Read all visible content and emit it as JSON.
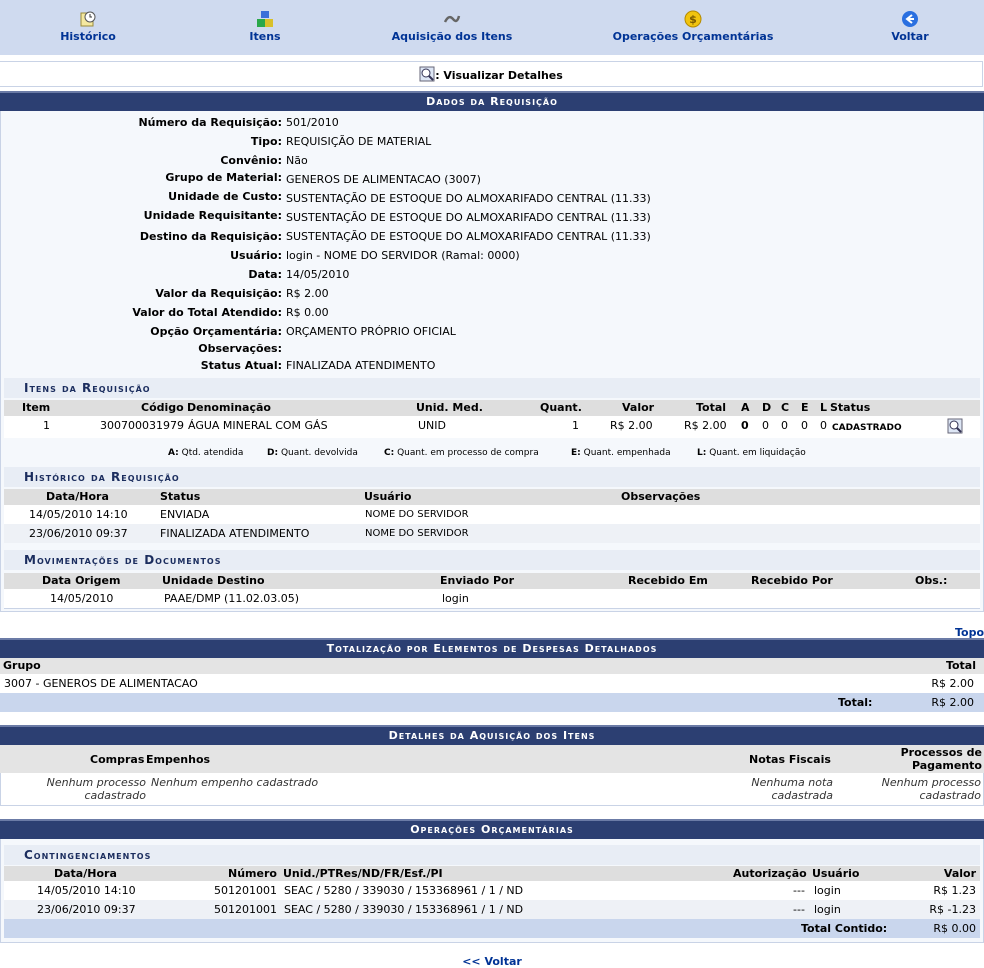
{
  "nav": [
    {
      "label": "Histórico",
      "icon": "clock-doc-icon"
    },
    {
      "label": "Itens",
      "icon": "cubes-icon"
    },
    {
      "label": "Aquisição dos Itens",
      "icon": "handshake-icon"
    },
    {
      "label": "Operações Orçamentárias",
      "icon": "coin-icon"
    },
    {
      "label": "Voltar",
      "icon": "back-arrow-icon"
    }
  ],
  "view_details": ": Visualizar Detalhes",
  "dados": {
    "title": "Dados da Requisição",
    "fields": [
      {
        "label": "Número da Requisição:",
        "value": "501/2010"
      },
      {
        "label": "Tipo:",
        "value": "REQUISIÇÃO DE MATERIAL"
      },
      {
        "label": "Convênio:",
        "value": "Não"
      },
      {
        "label": "Grupo de Material:",
        "value": "GENEROS DE ALIMENTACAO (3007)"
      },
      {
        "label": "Unidade de Custo:",
        "value": "SUSTENTAÇÃO DE ESTOQUE DO ALMOXARIFADO CENTRAL (11.33)"
      },
      {
        "label": "Unidade Requisitante:",
        "value": "SUSTENTAÇÃO DE ESTOQUE DO ALMOXARIFADO CENTRAL (11.33)"
      },
      {
        "label": "Destino da Requisição:",
        "value": "SUSTENTAÇÃO DE ESTOQUE DO ALMOXARIFADO CENTRAL (11.33)"
      },
      {
        "label": "Usuário:",
        "value": "login - NOME DO SERVIDOR (Ramal: 0000)"
      },
      {
        "label": "Data:",
        "value": "14/05/2010"
      },
      {
        "label": "Valor da Requisição:",
        "value": "R$ 2.00"
      },
      {
        "label": "Valor do Total Atendido:",
        "value": "R$ 0.00"
      },
      {
        "label": "Opção Orçamentária:",
        "value": "ORÇAMENTO PRÓPRIO OFICIAL"
      },
      {
        "label": "Observações:",
        "value": ""
      },
      {
        "label": "Status Atual:",
        "value": "FINALIZADA ATENDIMENTO"
      }
    ]
  },
  "itens": {
    "title": "Itens da Requisição",
    "headers": [
      "Item",
      "Código",
      "Denominação",
      "Unid. Med.",
      "Quant.",
      "Valor",
      "Total",
      "A",
      "D",
      "C",
      "E",
      "L",
      "Status"
    ],
    "rows": [
      [
        "1",
        "300700031979",
        "ÁGUA MINERAL COM GÁS",
        "UNID",
        "1",
        "R$ 2.00",
        "R$ 2.00",
        "0",
        "0",
        "0",
        "0",
        "0",
        "CADASTRADO"
      ]
    ],
    "legend": [
      {
        "k": "A:",
        "v": "Qtd. atendida"
      },
      {
        "k": "D:",
        "v": "Quant. devolvida"
      },
      {
        "k": "C:",
        "v": "Quant. em processo de compra"
      },
      {
        "k": "E:",
        "v": "Quant. empenhada"
      },
      {
        "k": "L:",
        "v": "Quant. em liquidação"
      }
    ]
  },
  "historico": {
    "title": "Histórico da Requisição",
    "headers": [
      "Data/Hora",
      "Status",
      "Usuário",
      "Observações"
    ],
    "rows": [
      [
        "14/05/2010 14:10",
        "ENVIADA",
        "NOME DO SERVIDOR",
        ""
      ],
      [
        "23/06/2010 09:37",
        "FINALIZADA ATENDIMENTO",
        "NOME DO SERVIDOR",
        ""
      ]
    ]
  },
  "movimentacoes": {
    "title": "Movimentações de Documentos",
    "headers": [
      "Data Origem",
      "Unidade Destino",
      "Enviado Por",
      "Recebido Em",
      "Recebido Por",
      "Obs.:"
    ],
    "rows": [
      [
        "14/05/2010",
        "PAAE/DMP (11.02.03.05)",
        "login",
        "",
        "",
        ""
      ]
    ]
  },
  "topo": "Topo",
  "totalizacao": {
    "title": "Totalização por Elementos de Despesas Detalhados",
    "headers": [
      "Grupo",
      "Total"
    ],
    "rows": [
      [
        "3007 - GENEROS DE ALIMENTACAO",
        "R$ 2.00"
      ]
    ],
    "total_label": "Total:",
    "total_value": "R$ 2.00"
  },
  "aquisicao": {
    "title": "Detalhes da Aquisição dos Itens",
    "headers": [
      "Compras",
      "Empenhos",
      "Notas Fiscais",
      "Processos de Pagamento"
    ],
    "row": [
      "Nenhum processo cadastrado",
      "Nenhum empenho cadastrado",
      "Nenhuma nota cadastrada",
      "Nenhum processo cadastrado"
    ]
  },
  "operacoes": {
    "title": "Operações Orçamentárias",
    "subtitle": "Contingenciamentos",
    "headers": [
      "Data/Hora",
      "Número",
      "Unid./PTRes/ND/FR/Esf./PI",
      "Autorização",
      "Usuário",
      "Valor"
    ],
    "rows": [
      [
        "14/05/2010 14:10",
        "501201001",
        "SEAC / 5280 / 339030 / 153368961 / 1 / ND",
        "---",
        "login",
        "R$ 1.23"
      ],
      [
        "23/06/2010 09:37",
        "501201001",
        "SEAC / 5280 / 339030 / 153368961 / 1 / ND",
        "---",
        "login",
        "R$ -1.23"
      ]
    ],
    "total_label": "Total Contido:",
    "total_value": "R$ 0.00"
  },
  "voltar_link": "<< Voltar"
}
